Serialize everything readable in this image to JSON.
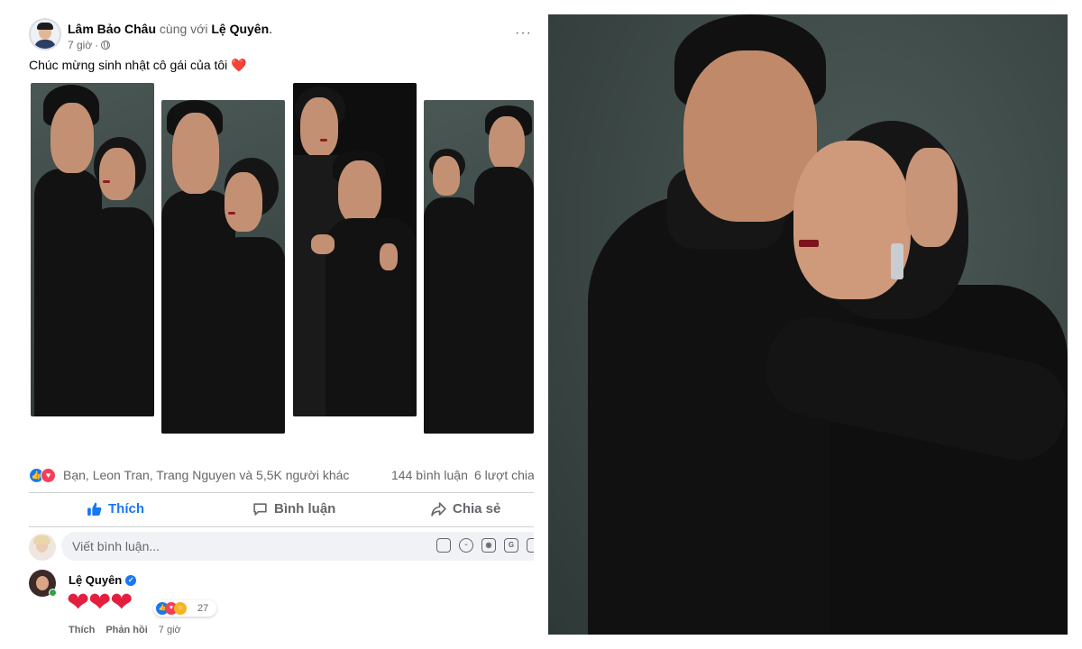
{
  "post": {
    "author": "Lâm Bảo Châu",
    "with_text": "cùng với",
    "tagged": "Lệ Quyên",
    "period": ".",
    "time": "7 giờ",
    "more": "···",
    "caption": "Chúc mừng sinh nhật cô gái của tôi",
    "caption_emoji": "❤️"
  },
  "reactions": {
    "summary": "Bạn, Leon Tran, Trang Nguyen và 5,5K người khác",
    "comments": "144 bình luận",
    "shares": "6 lượt chia"
  },
  "actions": {
    "like": "Thích",
    "comment": "Bình luận",
    "share": "Chia sẻ"
  },
  "composer": {
    "placeholder": "Viết bình luận...",
    "icons": [
      "sticker-icon",
      "emoji-icon",
      "camera-icon",
      "gif-icon",
      "gift-icon"
    ]
  },
  "comment": {
    "name": "Lệ Quyên",
    "body": "❤❤❤",
    "reaction_count": "27",
    "like": "Thích",
    "reply": "Phản hồi",
    "time": "7 giờ"
  },
  "colors": {
    "accent": "#1877f2",
    "love": "#f33e58",
    "photo_background": "#3f4b49"
  }
}
